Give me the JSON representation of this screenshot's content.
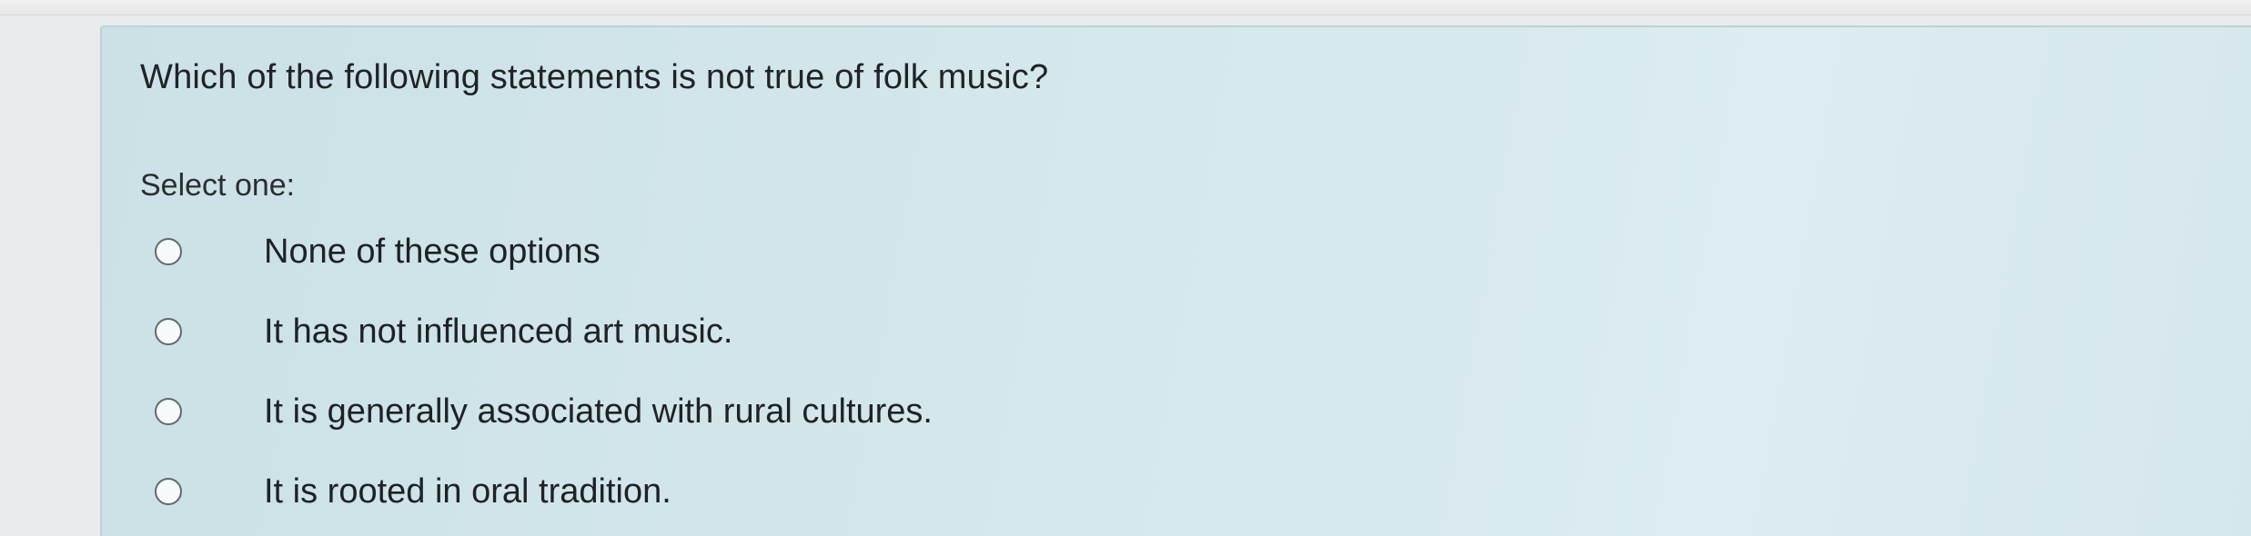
{
  "question": {
    "text": "Which of the following statements is not true of folk music?",
    "prompt": "Select one:",
    "options": [
      {
        "label": "None of these options",
        "selected": false
      },
      {
        "label": "It has not influenced art music.",
        "selected": false
      },
      {
        "label": "It is generally associated with rural cultures.",
        "selected": false
      },
      {
        "label": "It is rooted in oral tradition.",
        "selected": false
      }
    ]
  },
  "colors": {
    "panel_background": "#d5e8ec",
    "page_background": "#e9ecec",
    "text": "#202428",
    "radio_border": "#5f6a6f"
  }
}
